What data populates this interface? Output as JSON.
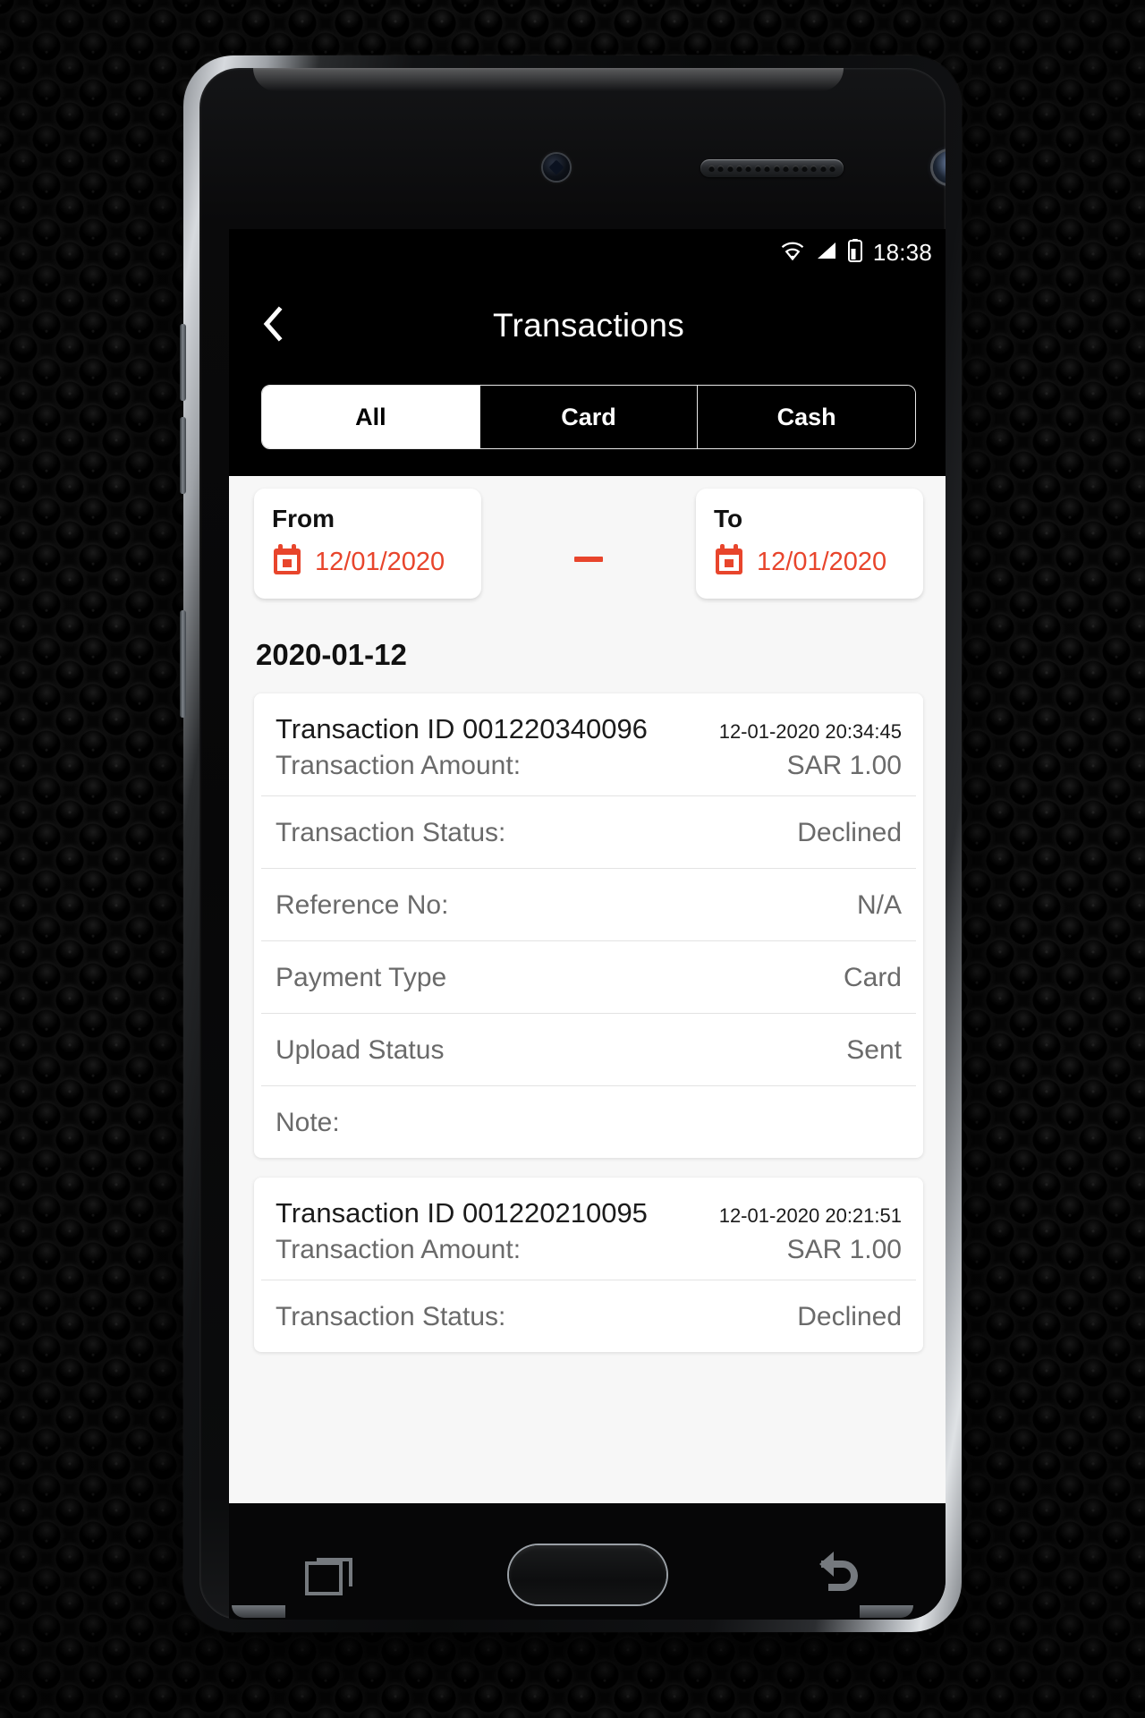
{
  "statusbar": {
    "time": "18:38",
    "icons": [
      "wifi-icon",
      "signal-icon",
      "battery-icon"
    ]
  },
  "appbar": {
    "back_icon": "chevron-left-icon",
    "title": "Transactions"
  },
  "tabs": [
    {
      "label": "All",
      "active": true
    },
    {
      "label": "Card",
      "active": false
    },
    {
      "label": "Cash",
      "active": false
    }
  ],
  "filters": {
    "from": {
      "label": "From",
      "value": "12/01/2020",
      "icon": "calendar-icon"
    },
    "to": {
      "label": "To",
      "value": "12/01/2020",
      "icon": "calendar-icon"
    },
    "separator": "-"
  },
  "day_group": {
    "date": "2020-01-12"
  },
  "transactions": [
    {
      "id_label": "Transaction ID 001220340096",
      "timestamp": "12-01-2020 20:34:45",
      "rows": [
        {
          "key": "Transaction Amount:",
          "value": "SAR 1.00"
        },
        {
          "key": "Transaction Status:",
          "value": "Declined"
        },
        {
          "key": "Reference No:",
          "value": "N/A"
        },
        {
          "key": "Payment Type",
          "value": "Card"
        },
        {
          "key": "Upload Status",
          "value": "Sent"
        },
        {
          "key": "Note:",
          "value": ""
        }
      ]
    },
    {
      "id_label": "Transaction ID 001220210095",
      "timestamp": "12-01-2020 20:21:51",
      "rows": [
        {
          "key": "Transaction Amount:",
          "value": "SAR 1.00"
        },
        {
          "key": "Transaction Status:",
          "value": "Declined"
        }
      ]
    }
  ],
  "device_nav": {
    "recents_icon": "recents-icon",
    "home_icon": "home-key",
    "back_icon": "back-arrow-icon"
  },
  "colors": {
    "accent": "#e8452c",
    "appbar_bg": "#000000",
    "screen_bg": "#f7f7f7",
    "card_bg": "#ffffff",
    "muted_text": "#6a6a6a"
  }
}
